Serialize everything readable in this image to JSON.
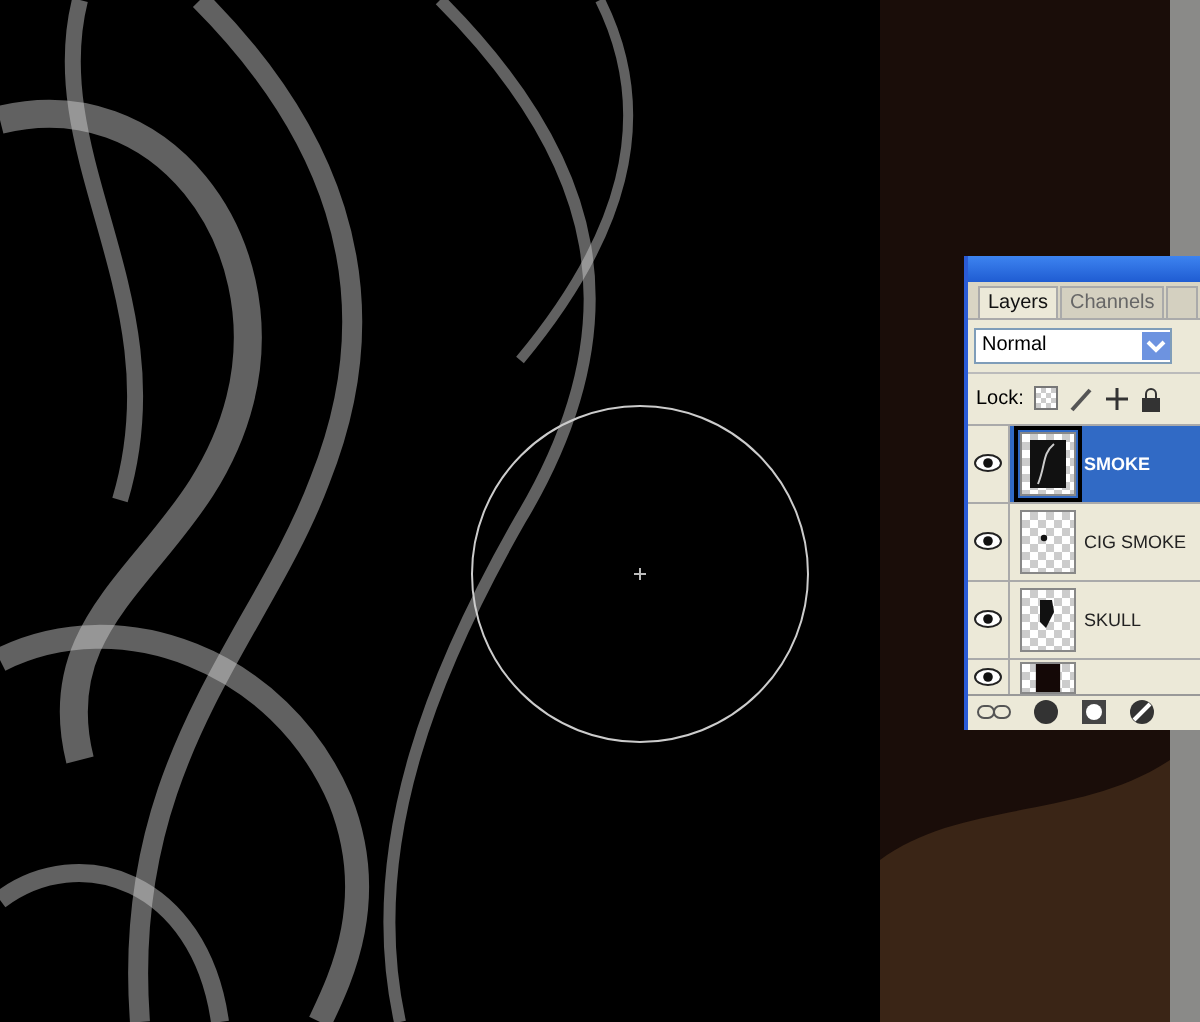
{
  "panel": {
    "tabs": [
      {
        "label": "Layers",
        "selected": true
      },
      {
        "label": "Channels",
        "selected": false
      }
    ],
    "blend_mode": {
      "value": "Normal"
    },
    "lock_label": "Lock:",
    "layers": [
      {
        "name": "SMOKE",
        "visible": true,
        "selected": true,
        "kind": "smoke"
      },
      {
        "name": "CIG SMOKE",
        "visible": true,
        "selected": false,
        "kind": "dot"
      },
      {
        "name": "SKULL",
        "visible": true,
        "selected": false,
        "kind": "skull"
      },
      {
        "visible": true,
        "selected": false,
        "kind": "dark"
      }
    ]
  }
}
